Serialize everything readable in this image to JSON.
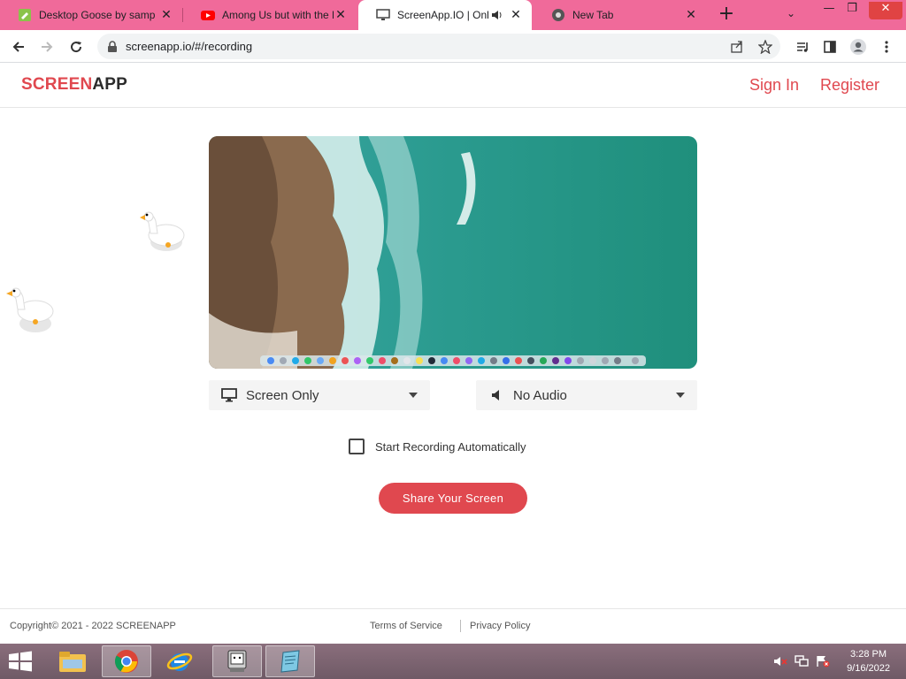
{
  "browser": {
    "tabs": [
      {
        "title": "Desktop Goose by samp",
        "favicon": "goose-doc-icon",
        "active": false
      },
      {
        "title": "Among Us but with the D",
        "favicon": "youtube-icon",
        "active": false
      },
      {
        "title": "ScreenApp.IO | Onlin",
        "favicon": "monitor-icon",
        "active": true,
        "audio": "speaker-icon"
      },
      {
        "title": "New Tab",
        "favicon": "chrome-icon",
        "active": false
      }
    ],
    "new_tab_label": "+",
    "tab_search_label": "⌄",
    "window_controls": {
      "minimize": "—",
      "restore": "❐",
      "close": "✕"
    },
    "url": "screenapp.io/#/recording",
    "tab_close_label": "✕"
  },
  "site": {
    "logo": {
      "part1": "SCREEN",
      "part2": "APP",
      "color1": "#e0484f",
      "color2": "#2b2b2b"
    },
    "nav": {
      "sign_in": "Sign In",
      "register": "Register"
    },
    "accent": "#e0484f"
  },
  "recorder": {
    "video_source": {
      "selected": "Screen Only",
      "icon": "monitor-icon"
    },
    "audio_source": {
      "selected": "No Audio",
      "icon": "speaker-icon"
    },
    "auto_start": {
      "label": "Start Recording Automatically",
      "checked": false
    },
    "share_button": "Share Your Screen"
  },
  "footer": {
    "copyright": "Copyright©   2021 - 2022 SCREENAPP",
    "terms": "Terms of Service",
    "privacy": "Privacy Policy"
  },
  "taskbar": {
    "items": [
      "windows-start-icon",
      "file-explorer-icon",
      "chrome-icon",
      "internet-explorer-icon",
      "goose-app-icon",
      "notepad-icon"
    ],
    "active_item": "chrome-icon",
    "tray": [
      "volume-muted-icon",
      "network-icon",
      "action-center-icon"
    ],
    "time": "3:28 PM",
    "date": "9/16/2022"
  }
}
